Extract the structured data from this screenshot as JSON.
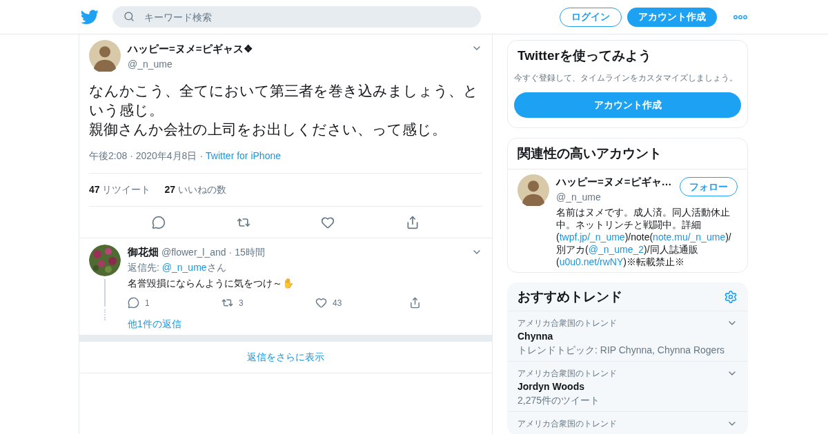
{
  "header": {
    "search": {
      "placeholder": "キーワード検索"
    },
    "login": "ログイン",
    "signup": "アカウント作成"
  },
  "tweet": {
    "name": "ハッピー=ヌメ=ピギャス❖",
    "handle": "@_n_ume",
    "text": [
      "なんかこう、全てにおいて第三者を巻き込みましょう、という感じ。",
      "親御さんか会社の上司をお出しください、って感じ。"
    ],
    "time": "午後2:08 · 2020年4月8日",
    "separator": "·",
    "source": "Twitter for iPhone",
    "stats": [
      "**47** リツイート",
      "**27** いいねの数"
    ]
  },
  "reply": {
    "name": "御花畑",
    "handle": "@flower_l_and",
    "separator": "·",
    "age": "15時間",
    "reply_to_prefix": "返信先: ",
    "reply_to": "@_n_ume",
    "reply_to_suffix": "さん",
    "text": "名誉毀損にならんように気をつけ～✋",
    "counts": [
      "1",
      "3",
      "43"
    ],
    "more_replies": "他1件の返信"
  },
  "show_more": "返信をさらに表示",
  "signup_card": {
    "title": "Twitterを使ってみよう",
    "subtitle": "今すぐ登録して、タイムラインをカスタマイズしましょう。",
    "button": "アカウント作成"
  },
  "related": {
    "title": "関連性の高いアカウント",
    "name": "ハッピー=ヌメ=ピギャ…",
    "handle": "@_n_ume",
    "follow": "フォロー",
    "bio": [
      {
        "kind": "text",
        "text": "名前はヌメです。成人済。同人活動休止中。ネットリンチと戦闘中。詳細("
      },
      {
        "kind": "link",
        "text": "twpf.jp/_n_ume"
      },
      {
        "kind": "text",
        "text": ")/note("
      },
      {
        "kind": "link",
        "text": "note.mu/_n_ume"
      },
      {
        "kind": "text",
        "text": ")/別アカ("
      },
      {
        "kind": "link",
        "text": "@_n_ume_2"
      },
      {
        "kind": "text",
        "text": ")/同人誌通販("
      },
      {
        "kind": "link",
        "text": "u0u0.net/rwNY"
      },
      {
        "kind": "text",
        "text": ")※転載禁止※"
      }
    ]
  },
  "trends": {
    "title": "おすすめトレンド",
    "items": [
      {
        "category": "アメリカ合衆国のトレンド",
        "name": "Chynna",
        "detail": "トレンドトピック: RIP Chynna, Chynna Rogers"
      },
      {
        "category": "アメリカ合衆国のトレンド",
        "name": "Jordyn Woods",
        "detail": "2,275件のツイート"
      },
      {
        "category": "アメリカ合衆国のトレンド"
      }
    ]
  }
}
